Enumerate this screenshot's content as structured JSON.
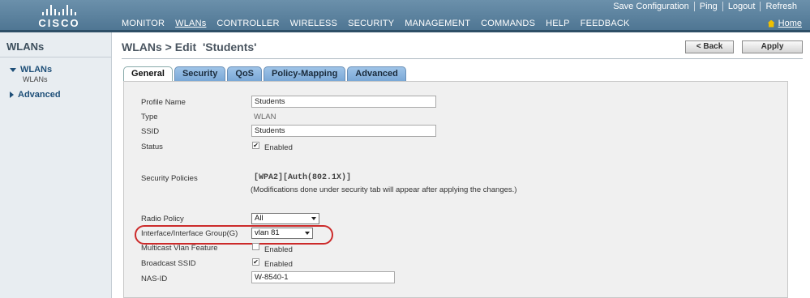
{
  "header": {
    "logo_text": "CISCO",
    "util_links": [
      "Save Configuration",
      "Ping",
      "Logout",
      "Refresh"
    ],
    "nav": [
      "MONITOR",
      "WLANs",
      "CONTROLLER",
      "WIRELESS",
      "SECURITY",
      "MANAGEMENT",
      "COMMANDS",
      "HELP",
      "FEEDBACK"
    ],
    "active_nav": "WLANs",
    "home_label": "Home"
  },
  "sidebar": {
    "title": "WLANs",
    "groups": [
      {
        "label": "WLANs",
        "expanded": true,
        "sub": [
          "WLANs"
        ]
      },
      {
        "label": "Advanced",
        "expanded": false
      }
    ]
  },
  "page": {
    "title": "WLANs > Edit  'Students'",
    "back_label": "< Back",
    "apply_label": "Apply"
  },
  "tabs": [
    "General",
    "Security",
    "QoS",
    "Policy-Mapping",
    "Advanced"
  ],
  "active_tab": "General",
  "form": {
    "profile_name_label": "Profile Name",
    "profile_name_value": "Students",
    "type_label": "Type",
    "type_value": "WLAN",
    "ssid_label": "SSID",
    "ssid_value": "Students",
    "status_label": "Status",
    "status_checked": true,
    "status_option": "Enabled",
    "security_policies_label": "Security Policies",
    "security_policies_value": "[WPA2][Auth(802.1X)]",
    "security_note": "(Modifications done under security tab will appear after applying the changes.)",
    "radio_policy_label": "Radio Policy",
    "radio_policy_value": "All",
    "interface_label": "Interface/Interface Group(G)",
    "interface_value": "vlan 81",
    "multicast_label": "Multicast Vlan Feature",
    "multicast_checked": false,
    "multicast_option": "Enabled",
    "broadcast_label": "Broadcast SSID",
    "broadcast_checked": true,
    "broadcast_option": "Enabled",
    "nas_id_label": "NAS-ID",
    "nas_id_value": "W-8540-1"
  },
  "colors": {
    "banner": "#5a80a0",
    "tab_blue": "#8ab4e0",
    "highlight_red": "#cc2a2a"
  }
}
